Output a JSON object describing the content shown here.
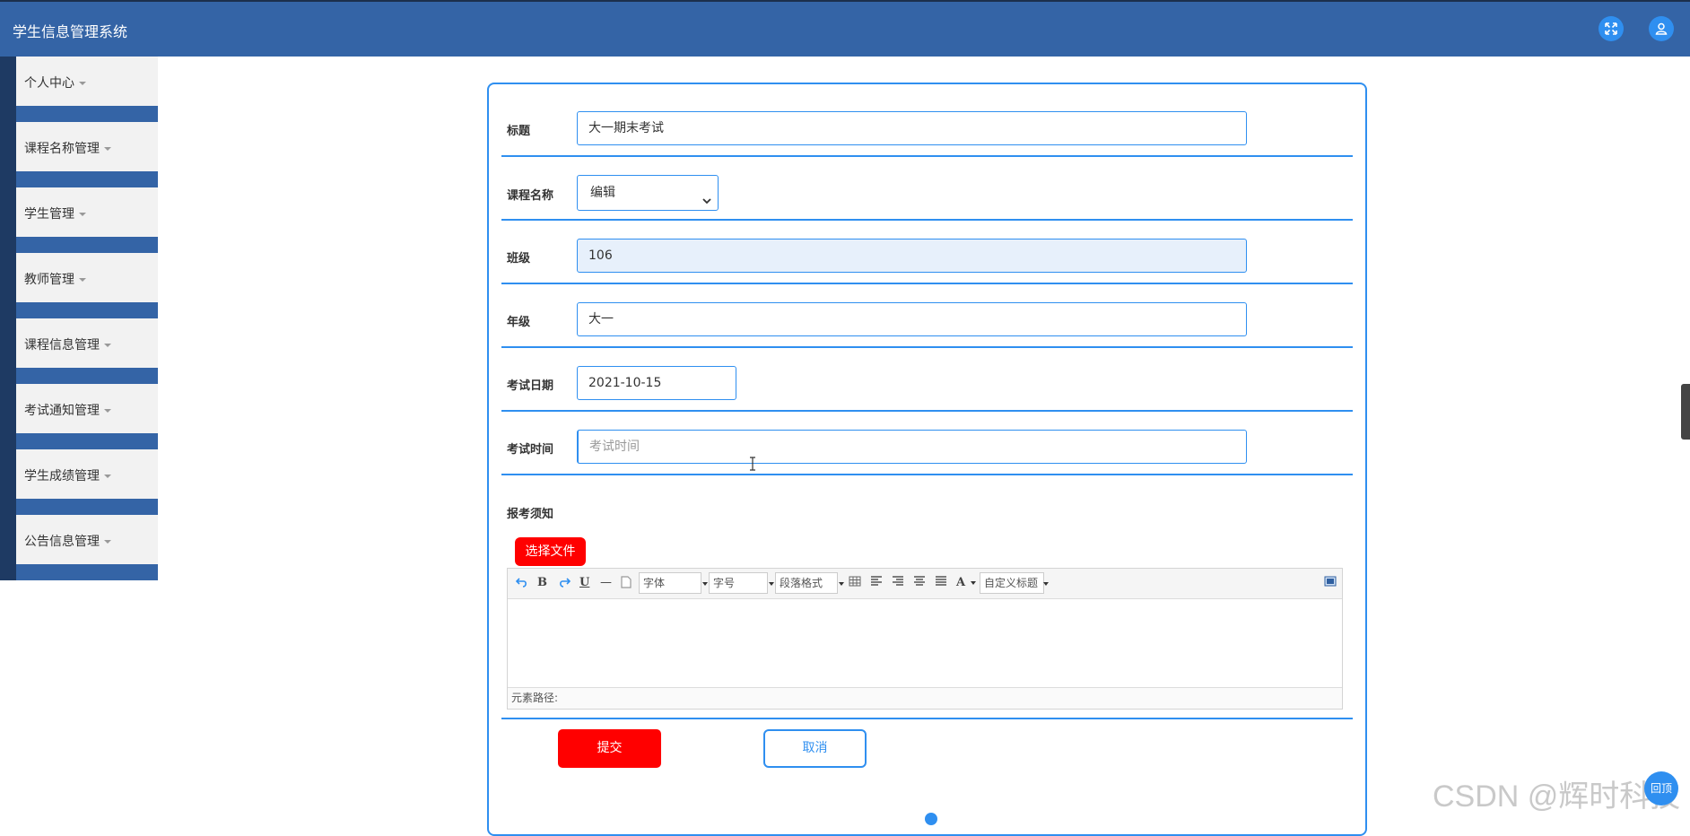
{
  "header": {
    "title": "学生信息管理系统"
  },
  "sidebar": {
    "items": [
      {
        "label": "个人中心"
      },
      {
        "label": "课程名称管理"
      },
      {
        "label": "学生管理"
      },
      {
        "label": "教师管理"
      },
      {
        "label": "课程信息管理"
      },
      {
        "label": "考试通知管理"
      },
      {
        "label": "学生成绩管理"
      },
      {
        "label": "公告信息管理"
      }
    ]
  },
  "form": {
    "title": {
      "label": "标题",
      "value": "大一期末考试"
    },
    "course": {
      "label": "课程名称",
      "value": "编辑"
    },
    "class": {
      "label": "班级",
      "value": "106"
    },
    "grade": {
      "label": "年级",
      "value": "大一"
    },
    "exam_date": {
      "label": "考试日期",
      "value": "2021-10-15"
    },
    "exam_time": {
      "label": "考试时间",
      "placeholder": "考试时间"
    },
    "notice": {
      "label": "报考须知",
      "upload_label": "选择文件"
    },
    "editor": {
      "font_label": "字体",
      "size_label": "字号",
      "paragraph_label": "段落格式",
      "custom_title_label": "自定义标题",
      "path_label": "元素路径:"
    },
    "submit_label": "提交",
    "cancel_label": "取消"
  },
  "watermark": "CSDN @辉时科技",
  "float_button_label": "回顶",
  "colors": {
    "primary": "#3464a6",
    "accent": "#2f8ff0",
    "danger": "#ff0000"
  }
}
